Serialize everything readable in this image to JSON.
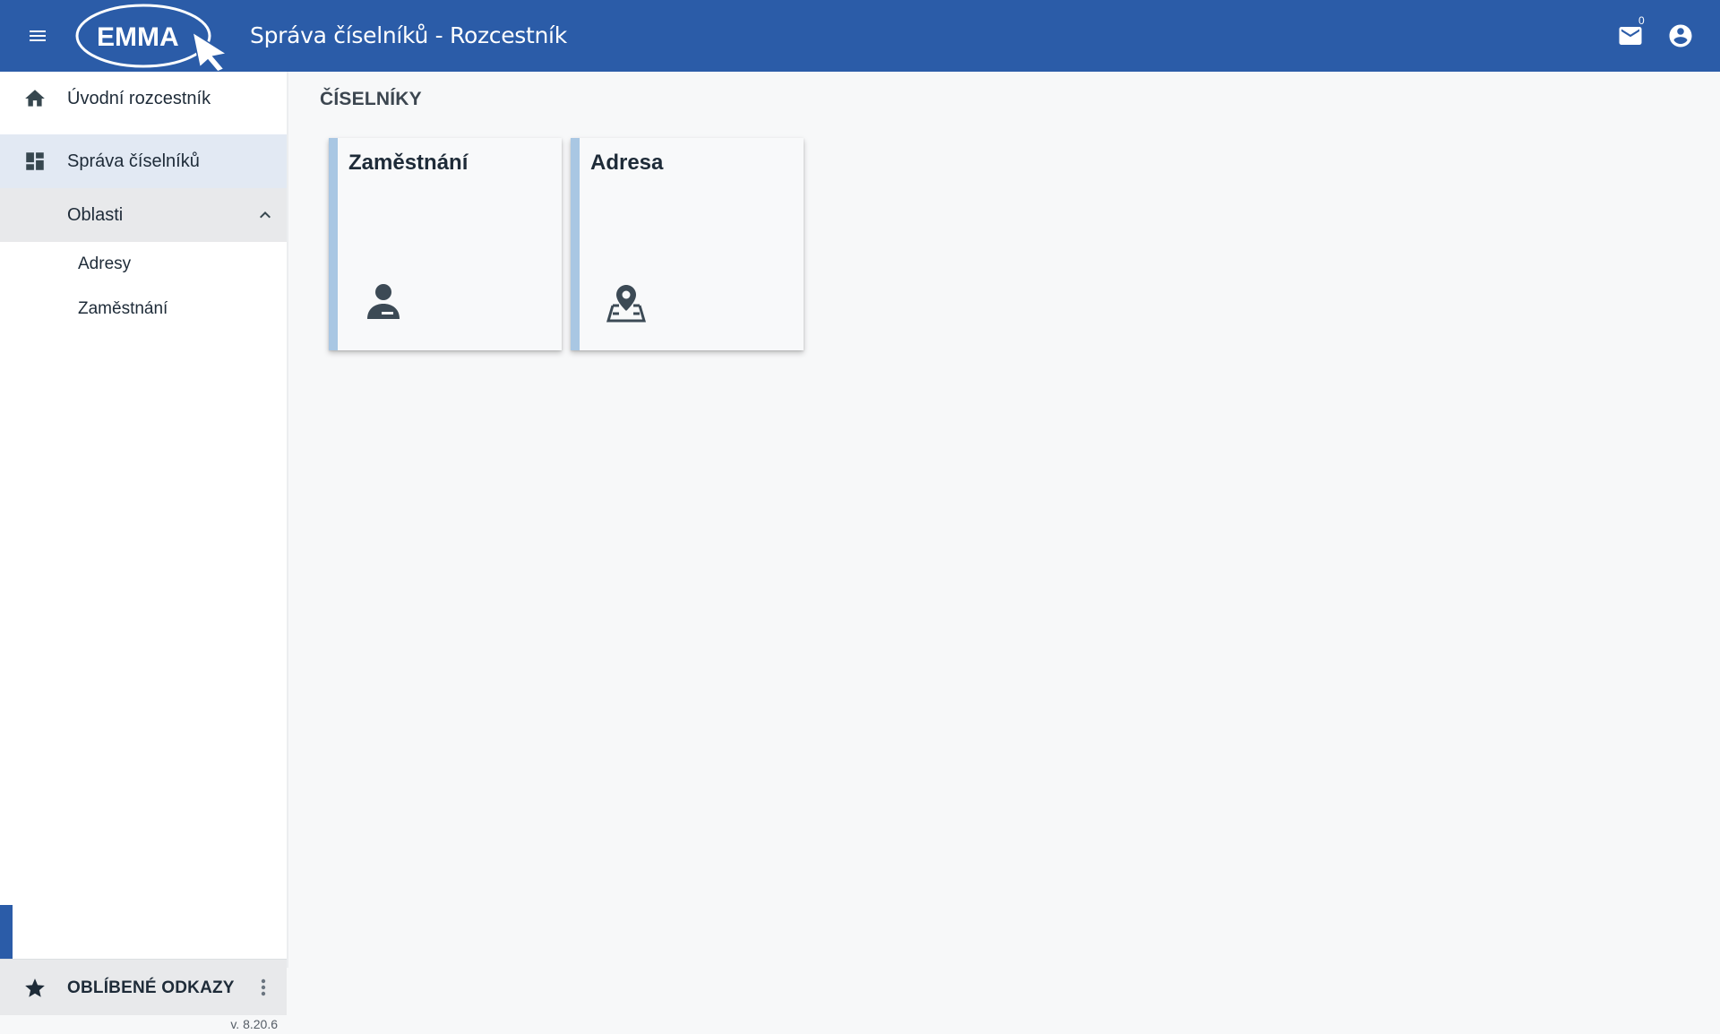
{
  "header": {
    "logo_text": "EMMA",
    "title": "Správa číselníků - Rozcestník",
    "mail_count": "0",
    "brand_color": "#2b5ca8"
  },
  "sidebar": {
    "items": [
      {
        "label": "Úvodní rozcestník",
        "icon": "home-icon"
      },
      {
        "label": "Správa číselníků",
        "icon": "dashboard-icon"
      },
      {
        "label": "Oblasti",
        "icon": "chevron-up-icon"
      }
    ],
    "sub_items": [
      {
        "label": "Adresy"
      },
      {
        "label": "Zaměstnání"
      }
    ],
    "favorites_label": "OBLÍBENÉ ODKAZY",
    "version": "v. 8.20.6"
  },
  "main": {
    "section_title": "ČÍSELNÍKY",
    "cards": [
      {
        "title": "Zaměstnání",
        "icon": "person-card-icon"
      },
      {
        "title": "Adresa",
        "icon": "map-pin-icon"
      }
    ],
    "accent_color": "#a9c7e3"
  }
}
